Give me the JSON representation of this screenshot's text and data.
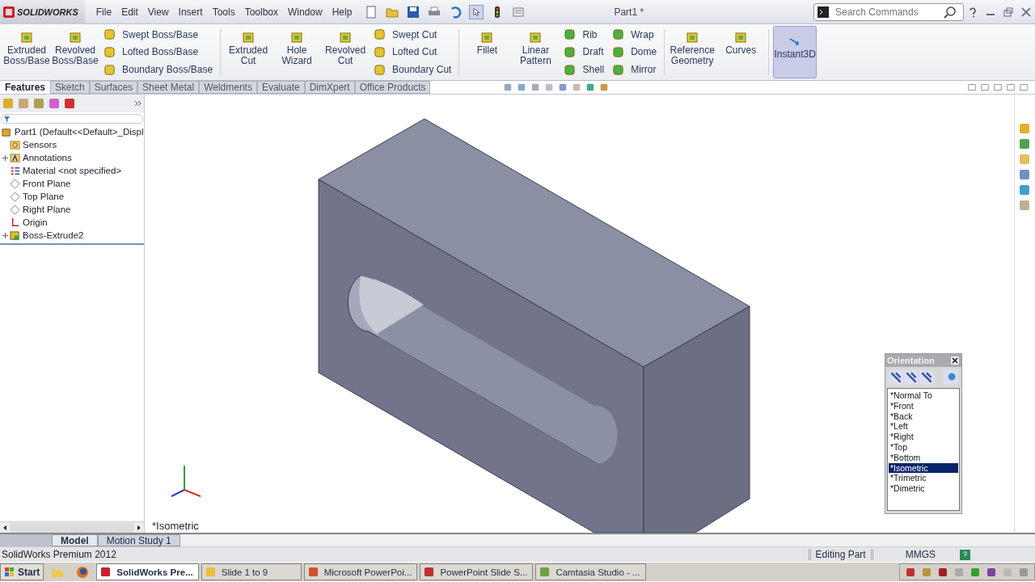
{
  "app": {
    "logo": "SOLIDWORKS",
    "document_title": "Part1 *"
  },
  "menu": [
    "File",
    "Edit",
    "View",
    "Insert",
    "Tools",
    "Toolbox",
    "Window",
    "Help"
  ],
  "search": {
    "placeholder": "Search Commands"
  },
  "ribbon": [
    {
      "items": [
        {
          "kind": "large",
          "label": "Extruded Boss/Base"
        },
        {
          "kind": "large",
          "label": "Revolved Boss/Base"
        },
        {
          "kind": "stack",
          "items": [
            "Swept Boss/Base",
            "Lofted Boss/Base",
            "Boundary Boss/Base"
          ]
        }
      ]
    },
    {
      "items": [
        {
          "kind": "large",
          "label": "Extruded Cut"
        },
        {
          "kind": "large",
          "label": "Hole Wizard"
        },
        {
          "kind": "large",
          "label": "Revolved Cut"
        },
        {
          "kind": "stack",
          "items": [
            "Swept Cut",
            "Lofted Cut",
            "Boundary Cut"
          ]
        }
      ]
    },
    {
      "items": [
        {
          "kind": "large",
          "label": "Fillet"
        },
        {
          "kind": "large",
          "label": "Linear Pattern"
        },
        {
          "kind": "stack",
          "items": [
            "Rib",
            "Draft",
            "Shell"
          ]
        },
        {
          "kind": "stack",
          "items": [
            "Wrap",
            "Dome",
            "Mirror"
          ]
        }
      ]
    },
    {
      "items": [
        {
          "kind": "large",
          "label": "Reference Geometry"
        },
        {
          "kind": "large",
          "label": "Curves"
        }
      ]
    },
    {
      "items": [
        {
          "kind": "toggle",
          "label": "Instant3D",
          "on": true
        }
      ]
    }
  ],
  "command_tabs": [
    {
      "label": "Features",
      "selected": true
    },
    {
      "label": "Sketch",
      "selected": false
    },
    {
      "label": "Surfaces",
      "selected": false
    },
    {
      "label": "Sheet Metal",
      "selected": false
    },
    {
      "label": "Weldments",
      "selected": false
    },
    {
      "label": "Evaluate",
      "selected": false
    },
    {
      "label": "DimXpert",
      "selected": false
    },
    {
      "label": "Office Products",
      "selected": false
    }
  ],
  "feature_tree": {
    "root": "Part1  (Default<<Default>_Displ",
    "items": [
      {
        "label": "Sensors",
        "kind": "sensors",
        "has_children": false
      },
      {
        "label": "Annotations",
        "kind": "annotations",
        "has_children": true
      },
      {
        "label": "Material <not specified>",
        "kind": "material",
        "has_children": false
      },
      {
        "label": "Front Plane",
        "kind": "plane",
        "has_children": false
      },
      {
        "label": "Top Plane",
        "kind": "plane",
        "has_children": false
      },
      {
        "label": "Right Plane",
        "kind": "plane",
        "has_children": false
      },
      {
        "label": "Origin",
        "kind": "origin",
        "has_children": false
      },
      {
        "label": "Boss-Extrude2",
        "kind": "feature",
        "has_children": true
      }
    ]
  },
  "view_label": "*Isometric",
  "orientation": {
    "title": "Orientation",
    "views": [
      {
        "label": "*Normal To",
        "selected": false
      },
      {
        "label": "*Front",
        "selected": false
      },
      {
        "label": "*Back",
        "selected": false
      },
      {
        "label": "*Left",
        "selected": false
      },
      {
        "label": "*Right",
        "selected": false
      },
      {
        "label": "*Top",
        "selected": false
      },
      {
        "label": "*Bottom",
        "selected": false
      },
      {
        "label": "*Isometric",
        "selected": true
      },
      {
        "label": "*Trimetric",
        "selected": false
      },
      {
        "label": "*Dimetric",
        "selected": false
      }
    ]
  },
  "bottom_tabs": [
    {
      "label": "Model",
      "selected": true
    },
    {
      "label": "Motion Study 1",
      "selected": false
    }
  ],
  "status_bar": {
    "product": "SolidWorks Premium 2012",
    "mode": "Editing Part",
    "units": "MMGS"
  },
  "taskbar": {
    "start": "Start",
    "tasks": [
      {
        "label": "SolidWorks Pre...",
        "selected": true
      },
      {
        "label": "Slide 1 to 9",
        "selected": false
      },
      {
        "label": "Microsoft PowerPoi...",
        "selected": false
      },
      {
        "label": "PowerPoint Slide S...",
        "selected": false
      },
      {
        "label": "Camtasia Studio - ...",
        "selected": false
      }
    ]
  }
}
